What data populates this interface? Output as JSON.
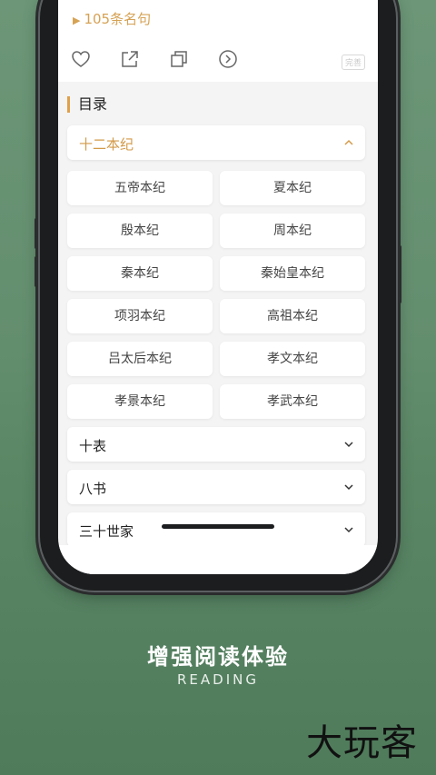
{
  "header": {
    "quote_count": "105条名句",
    "badge": "完善",
    "icons": [
      "heart-icon",
      "share-icon",
      "copy-icon",
      "next-circle-icon"
    ]
  },
  "toc": {
    "title": "目录",
    "open_section": "十二本纪",
    "items": [
      "五帝本纪",
      "夏本纪",
      "殷本纪",
      "周本纪",
      "秦本纪",
      "秦始皇本纪",
      "项羽本纪",
      "高祖本纪",
      "吕太后本纪",
      "孝文本纪",
      "孝景本纪",
      "孝武本纪"
    ],
    "collapsed_sections": [
      "十表",
      "八书",
      "三十世家"
    ]
  },
  "caption": {
    "main": "增强阅读体验",
    "sub": "READING"
  },
  "brand": "大玩客",
  "colors": {
    "accent": "#d39a48",
    "background": "#638e6e"
  }
}
